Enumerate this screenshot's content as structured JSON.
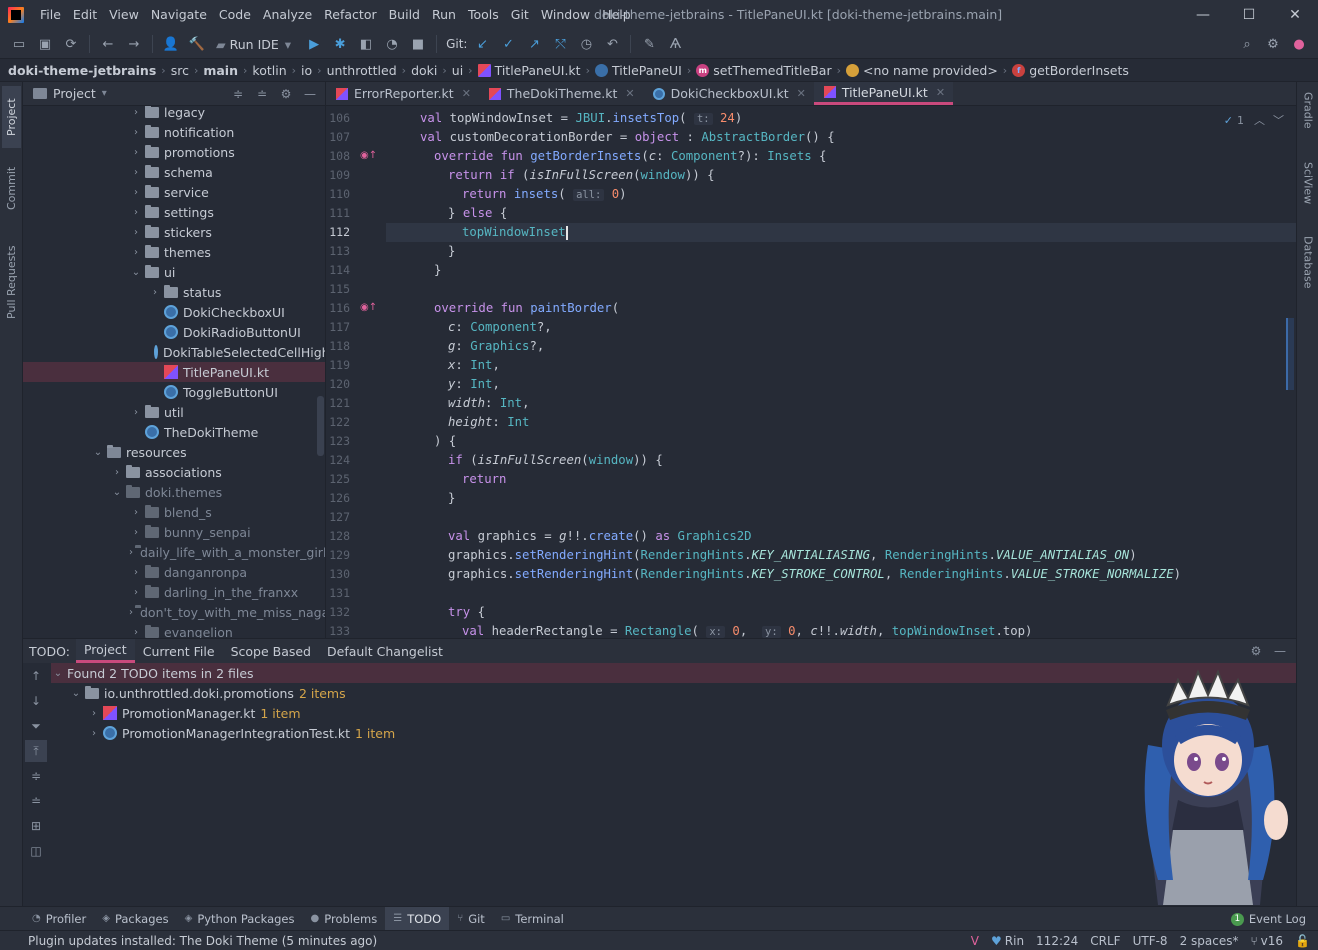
{
  "menu": [
    "File",
    "Edit",
    "View",
    "Navigate",
    "Code",
    "Analyze",
    "Refactor",
    "Build",
    "Run",
    "Tools",
    "Git",
    "Window",
    "Help"
  ],
  "window_title": "doki-theme-jetbrains - TitlePaneUI.kt [doki-theme-jetbrains.main]",
  "toolbar": {
    "run_config": "Run IDE",
    "git_label": "Git:"
  },
  "breadcrumbs": [
    "doki-theme-jetbrains",
    "src",
    "main",
    "kotlin",
    "io",
    "unthrottled",
    "doki",
    "ui",
    "TitlePaneUI.kt",
    "TitlePaneUI",
    "setThemedTitleBar",
    "<no name provided>",
    "getBorderInsets"
  ],
  "left_tabs": {
    "project": "Project",
    "commit": "Commit",
    "pull_requests": "Pull Requests"
  },
  "right_tabs": {
    "gradle": "Gradle",
    "sciview": "SciView",
    "database": "Database"
  },
  "project_panel": {
    "title": "Project",
    "tree": [
      {
        "label": "legacy",
        "depth": 6,
        "kind": "folder",
        "arrow": "›"
      },
      {
        "label": "notification",
        "depth": 6,
        "kind": "folder",
        "arrow": "›"
      },
      {
        "label": "promotions",
        "depth": 6,
        "kind": "folder",
        "arrow": "›"
      },
      {
        "label": "schema",
        "depth": 6,
        "kind": "folder",
        "arrow": "›"
      },
      {
        "label": "service",
        "depth": 6,
        "kind": "folder",
        "arrow": "›"
      },
      {
        "label": "settings",
        "depth": 6,
        "kind": "folder",
        "arrow": "›"
      },
      {
        "label": "stickers",
        "depth": 6,
        "kind": "folder",
        "arrow": "›"
      },
      {
        "label": "themes",
        "depth": 6,
        "kind": "folder",
        "arrow": "›"
      },
      {
        "label": "ui",
        "depth": 6,
        "kind": "folder",
        "arrow": "⌄"
      },
      {
        "label": "status",
        "depth": 7,
        "kind": "folder",
        "arrow": "›"
      },
      {
        "label": "DokiCheckboxUI",
        "depth": 7,
        "kind": "class",
        "arrow": ""
      },
      {
        "label": "DokiRadioButtonUI",
        "depth": 7,
        "kind": "class",
        "arrow": ""
      },
      {
        "label": "DokiTableSelectedCellHighlighter",
        "depth": 7,
        "kind": "class",
        "arrow": ""
      },
      {
        "label": "TitlePaneUI.kt",
        "depth": 7,
        "kind": "kotlin",
        "arrow": "",
        "selected": true
      },
      {
        "label": "ToggleButtonUI",
        "depth": 7,
        "kind": "class",
        "arrow": ""
      },
      {
        "label": "util",
        "depth": 6,
        "kind": "folder",
        "arrow": "›"
      },
      {
        "label": "TheDokiTheme",
        "depth": 6,
        "kind": "class",
        "arrow": ""
      },
      {
        "label": "resources",
        "depth": 4,
        "kind": "res",
        "arrow": "⌄"
      },
      {
        "label": "associations",
        "depth": 5,
        "kind": "folder",
        "arrow": "›"
      },
      {
        "label": "doki.themes",
        "depth": 5,
        "kind": "folder-dim",
        "arrow": "⌄"
      },
      {
        "label": "blend_s",
        "depth": 6,
        "kind": "folder-dim",
        "arrow": "›"
      },
      {
        "label": "bunny_senpai",
        "depth": 6,
        "kind": "folder-dim",
        "arrow": "›"
      },
      {
        "label": "daily_life_with_a_monster_girl",
        "depth": 6,
        "kind": "folder-dim",
        "arrow": "›"
      },
      {
        "label": "danganronpa",
        "depth": 6,
        "kind": "folder-dim",
        "arrow": "›"
      },
      {
        "label": "darling_in_the_franxx",
        "depth": 6,
        "kind": "folder-dim",
        "arrow": "›"
      },
      {
        "label": "don't_toy_with_me_miss_nagatoro",
        "depth": 6,
        "kind": "folder-dim",
        "arrow": "›"
      },
      {
        "label": "evangelion",
        "depth": 6,
        "kind": "folder-dim",
        "arrow": "›"
      }
    ]
  },
  "editor_tabs": [
    {
      "label": "ErrorReporter.kt",
      "kind": "kotlin",
      "active": false
    },
    {
      "label": "TheDokiTheme.kt",
      "kind": "kotlin",
      "active": false
    },
    {
      "label": "DokiCheckboxUI.kt",
      "kind": "class",
      "active": false
    },
    {
      "label": "TitlePaneUI.kt",
      "kind": "kotlin",
      "active": true
    }
  ],
  "editor": {
    "inspection_count": "1",
    "current_line": "112",
    "lines": [
      {
        "n": "106",
        "html": "<span class=\"kw\">val</span> topWindowInset = <span class=\"ty\">JBUI</span>.<span class=\"fn\">insetsTop</span>( <span class=\"hint\">t:</span> <span class=\"num\">24</span>)",
        "indent": 0
      },
      {
        "n": "107",
        "html": "<span class=\"kw\">val</span> customDecorationBorder = <span class=\"kw\">object</span> : <span class=\"ty\">AbstractBorder</span>() {",
        "indent": 0
      },
      {
        "n": "108",
        "html": "<span class=\"kw\">override fun</span> <span class=\"fn\">getBorderInsets</span>(<span class=\"it\">c</span>: <span class=\"ty\">Component</span>?): <span class=\"ty\">Insets</span> {",
        "indent": 1,
        "mark": true
      },
      {
        "n": "109",
        "html": "<span class=\"kw\">return if</span> (<span class=\"it\">isInFullScreen</span>(<span class=\"ty\">window</span>)) {",
        "indent": 2
      },
      {
        "n": "110",
        "html": "<span class=\"kw\">return</span> <span class=\"fn\">insets</span>( <span class=\"hint\">all:</span> <span class=\"num\">0</span>)",
        "indent": 3
      },
      {
        "n": "111",
        "html": "} <span class=\"kw\">else</span> {",
        "indent": 2
      },
      {
        "n": "112",
        "html": "<span class=\"ty\">topWindowInse</span><span class=\"ty\">t</span><span class=\"caret\"></span>",
        "indent": 3
      },
      {
        "n": "113",
        "html": "}",
        "indent": 2
      },
      {
        "n": "114",
        "html": "}",
        "indent": 1
      },
      {
        "n": "115",
        "html": "",
        "indent": 0
      },
      {
        "n": "116",
        "html": "<span class=\"kw\">override fun</span> <span class=\"fn\">paintBorder</span>(",
        "indent": 1,
        "mark": true
      },
      {
        "n": "117",
        "html": "<span class=\"it\">c</span>: <span class=\"ty\">Component</span>?,",
        "indent": 2
      },
      {
        "n": "118",
        "html": "<span class=\"it\">g</span>: <span class=\"ty\">Graphics</span>?,",
        "indent": 2
      },
      {
        "n": "119",
        "html": "<span class=\"it\">x</span>: <span class=\"ty\">Int</span>,",
        "indent": 2
      },
      {
        "n": "120",
        "html": "<span class=\"it\">y</span>: <span class=\"ty\">Int</span>,",
        "indent": 2
      },
      {
        "n": "121",
        "html": "<span class=\"it\">width</span>: <span class=\"ty\">Int</span>,",
        "indent": 2
      },
      {
        "n": "122",
        "html": "<span class=\"it\">height</span>: <span class=\"ty\">Int</span>",
        "indent": 2
      },
      {
        "n": "123",
        "html": ") {",
        "indent": 1
      },
      {
        "n": "124",
        "html": "<span class=\"kw\">if</span> (<span class=\"it\">isInFullScreen</span>(<span class=\"ty\">window</span>)) {",
        "indent": 2
      },
      {
        "n": "125",
        "html": "<span class=\"kw\">return</span>",
        "indent": 3
      },
      {
        "n": "126",
        "html": "}",
        "indent": 2
      },
      {
        "n": "127",
        "html": "",
        "indent": 0
      },
      {
        "n": "128",
        "html": "<span class=\"kw\">val</span> graphics = <span class=\"it\">g</span>!!.<span class=\"fn\">create</span>() <span class=\"kw\">as</span> <span class=\"ty\">Graphics2D</span>",
        "indent": 2
      },
      {
        "n": "129",
        "html": "graphics.<span class=\"fn\">setRenderingHint</span>(<span class=\"ty\">RenderingHints</span>.<span class=\"cst\">KEY_ANTIALIASING</span>, <span class=\"ty\">RenderingHints</span>.<span class=\"cst\">VALUE_ANTIALIAS_ON</span>)",
        "indent": 2
      },
      {
        "n": "130",
        "html": "graphics.<span class=\"fn\">setRenderingHint</span>(<span class=\"ty\">RenderingHints</span>.<span class=\"cst\">KEY_STROKE_CONTROL</span>, <span class=\"ty\">RenderingHints</span>.<span class=\"cst\">VALUE_STROKE_NORMALIZE</span>)",
        "indent": 2
      },
      {
        "n": "131",
        "html": "",
        "indent": 0
      },
      {
        "n": "132",
        "html": "<span class=\"kw\">try</span> {",
        "indent": 2
      },
      {
        "n": "133",
        "html": "<span class=\"kw\">val</span> headerRectangle = <span class=\"ty\">Rectangle</span>( <span class=\"hint\">x:</span> <span class=\"num\">0</span>,  <span class=\"hint\">y:</span> <span class=\"num\">0</span>, <span class=\"it\">c</span>!!.<span class=\"it\">width</span>, <span class=\"ty\">topWindowInset</span>.top)",
        "indent": 3
      }
    ]
  },
  "todo_panel": {
    "label": "TODO:",
    "tabs": [
      {
        "label": "Project",
        "active": true
      },
      {
        "label": "Current File",
        "active": false
      },
      {
        "label": "Scope Based",
        "active": false
      },
      {
        "label": "Default Changelist",
        "active": false
      }
    ],
    "summary": "Found 2 TODO items in 2 files",
    "groups": [
      {
        "label": "io.unthrottled.doki.promotions",
        "count": "2 items",
        "kind": "package"
      },
      {
        "label": "PromotionManager.kt",
        "count": "1 item",
        "kind": "kotlin"
      },
      {
        "label": "PromotionManagerIntegrationTest.kt",
        "count": "1 item",
        "kind": "class"
      }
    ]
  },
  "bottom_tabs": [
    {
      "label": "Profiler",
      "icon": "profiler-icon",
      "active": false
    },
    {
      "label": "Packages",
      "icon": "packages-icon",
      "active": false
    },
    {
      "label": "Python Packages",
      "icon": "python-packages-icon",
      "active": false
    },
    {
      "label": "Problems",
      "icon": "problems-icon",
      "active": false
    },
    {
      "label": "TODO",
      "icon": "todo-icon",
      "active": true
    },
    {
      "label": "Git",
      "icon": "git-icon",
      "active": false
    },
    {
      "label": "Terminal",
      "icon": "terminal-icon",
      "active": false
    }
  ],
  "event_log": {
    "count": "1",
    "label": "Event Log"
  },
  "status_bar": {
    "message": "Plugin updates installed: The Doki Theme (5 minutes ago)",
    "theme_name": "Rin",
    "position": "112:24",
    "line_sep": "CRLF",
    "encoding": "UTF-8",
    "indent": "2 spaces*",
    "vcs": "v16"
  },
  "colors": {
    "accent": "#c94a7d",
    "background": "#262b36",
    "chrome": "#2b303b",
    "keyword": "#c792ea",
    "function": "#82aaff",
    "type": "#56b6c2",
    "number": "#f78c6c"
  }
}
